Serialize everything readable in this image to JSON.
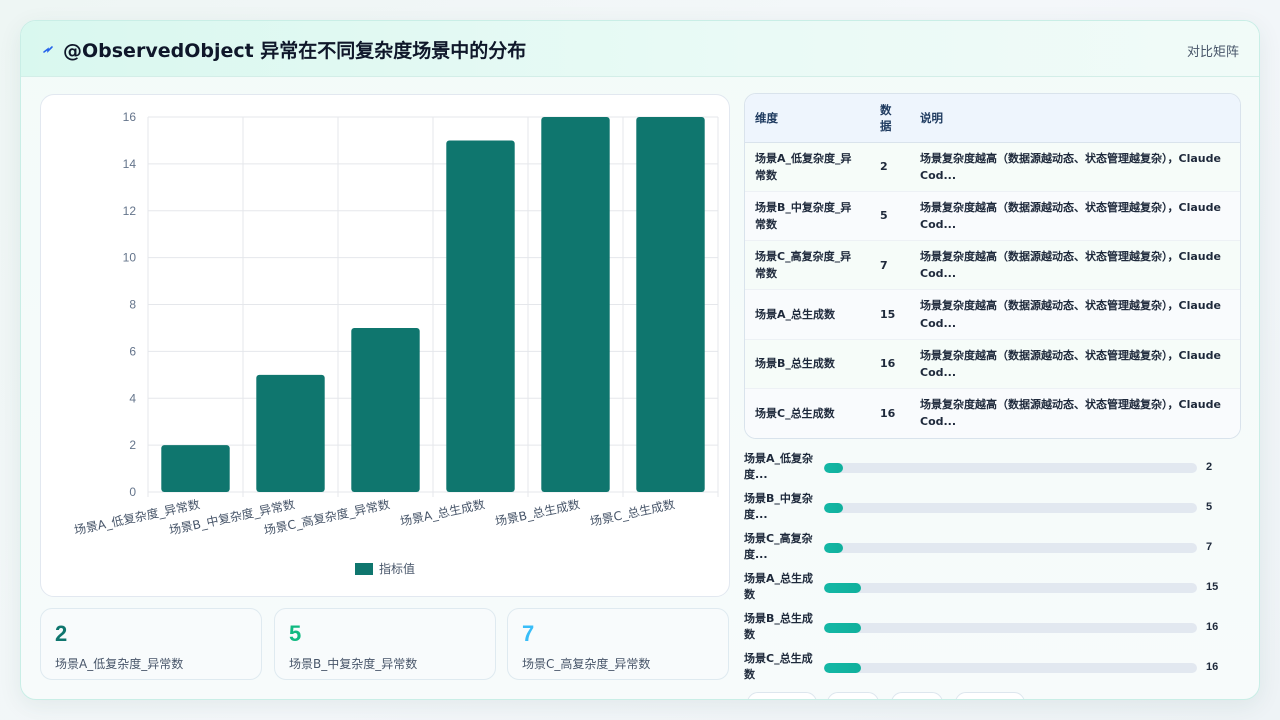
{
  "header": {
    "title": "@ObservedObject 异常在不同复杂度场景中的分布",
    "tag": "对比矩阵",
    "logo_icon": "lightning-icon"
  },
  "colors": {
    "bar": "#0f766e",
    "accent": "#14b8a6",
    "stat1": "#0f766e",
    "stat2": "#10b981",
    "stat3": "#38bdf8"
  },
  "chart_data": {
    "type": "bar",
    "categories": [
      "场景A_低复杂度_异常数",
      "场景B_中复杂度_异常数",
      "场景C_高复杂度_异常数",
      "场景A_总生成数",
      "场景B_总生成数",
      "场景C_总生成数"
    ],
    "series": [
      {
        "name": "指标值",
        "values": [
          2,
          5,
          7,
          15,
          16,
          16
        ]
      }
    ],
    "ylim": [
      0,
      16
    ],
    "yticks": [
      0,
      2,
      4,
      6,
      8,
      10,
      12,
      14,
      16
    ],
    "grid": true,
    "legend": "bottom"
  },
  "stats": [
    {
      "value": "2",
      "label": "场景A_低复杂度_异常数"
    },
    {
      "value": "5",
      "label": "场景B_中复杂度_异常数"
    },
    {
      "value": "7",
      "label": "场景C_高复杂度_异常数"
    }
  ],
  "table": {
    "headers": [
      "维度",
      "数据",
      "说明"
    ],
    "rows": [
      {
        "dim": "场景A_低复杂度_异常数",
        "val": "2",
        "desc": "场景复杂度越高（数据源越动态、状态管理越复杂），Claude Cod..."
      },
      {
        "dim": "场景B_中复杂度_异常数",
        "val": "5",
        "desc": "场景复杂度越高（数据源越动态、状态管理越复杂），Claude Cod..."
      },
      {
        "dim": "场景C_高复杂度_异常数",
        "val": "7",
        "desc": "场景复杂度越高（数据源越动态、状态管理越复杂），Claude Cod..."
      },
      {
        "dim": "场景A_总生成数",
        "val": "15",
        "desc": "场景复杂度越高（数据源越动态、状态管理越复杂），Claude Cod..."
      },
      {
        "dim": "场景B_总生成数",
        "val": "16",
        "desc": "场景复杂度越高（数据源越动态、状态管理越复杂），Claude Cod..."
      },
      {
        "dim": "场景C_总生成数",
        "val": "16",
        "desc": "场景复杂度越高（数据源越动态、状态管理越复杂），Claude Cod..."
      }
    ]
  },
  "progress": [
    {
      "label": "场景A_低复杂度...",
      "value": "2",
      "fraction": 0.05
    },
    {
      "label": "场景B_中复杂度...",
      "value": "5",
      "fraction": 0.05
    },
    {
      "label": "场景C_高复杂度...",
      "value": "7",
      "fraction": 0.05
    },
    {
      "label": "场景A_总生成数",
      "value": "15",
      "fraction": 0.1
    },
    {
      "label": "场景B_总生成数",
      "value": "16",
      "fraction": 0.1
    },
    {
      "label": "场景C_总生成数",
      "value": "16",
      "fraction": 0.1
    }
  ]
}
